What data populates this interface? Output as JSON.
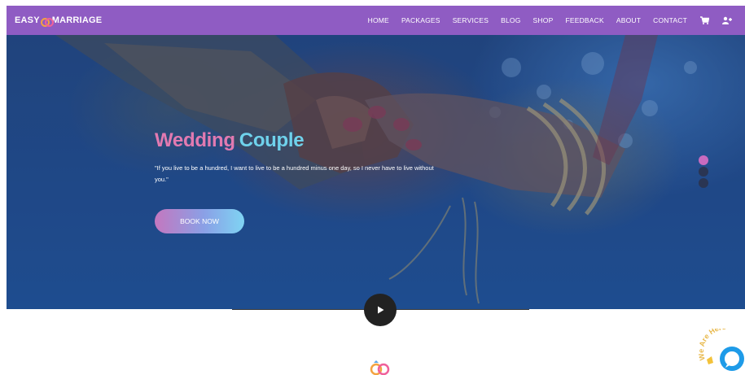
{
  "nav": {
    "logo_left": "EASY",
    "logo_right": "MARRIAGE",
    "items": [
      "HOME",
      "PACKAGES",
      "SERVICES",
      "BLOG",
      "SHOP",
      "FEEDBACK",
      "ABOUT",
      "CONTACT"
    ],
    "icons": [
      "cart-icon",
      "user-add-icon"
    ]
  },
  "hero": {
    "title_word1": "Wedding",
    "title_word2": "Couple",
    "quote": "\"If you live to be a hundred, I want to live to be a hundred minus one day, so I never have to live without you.\"",
    "button_label": "BOOK NOW",
    "slide_count": 3,
    "active_slide": 1
  },
  "chat": {
    "badge_text": "We Are Here"
  },
  "colors": {
    "nav_bg": "#8f5cc3",
    "title_pink": "#e27ab1",
    "title_cyan": "#6fd2ec",
    "dot_active": "#c86bbf",
    "chat_blue": "#1e9be8"
  }
}
